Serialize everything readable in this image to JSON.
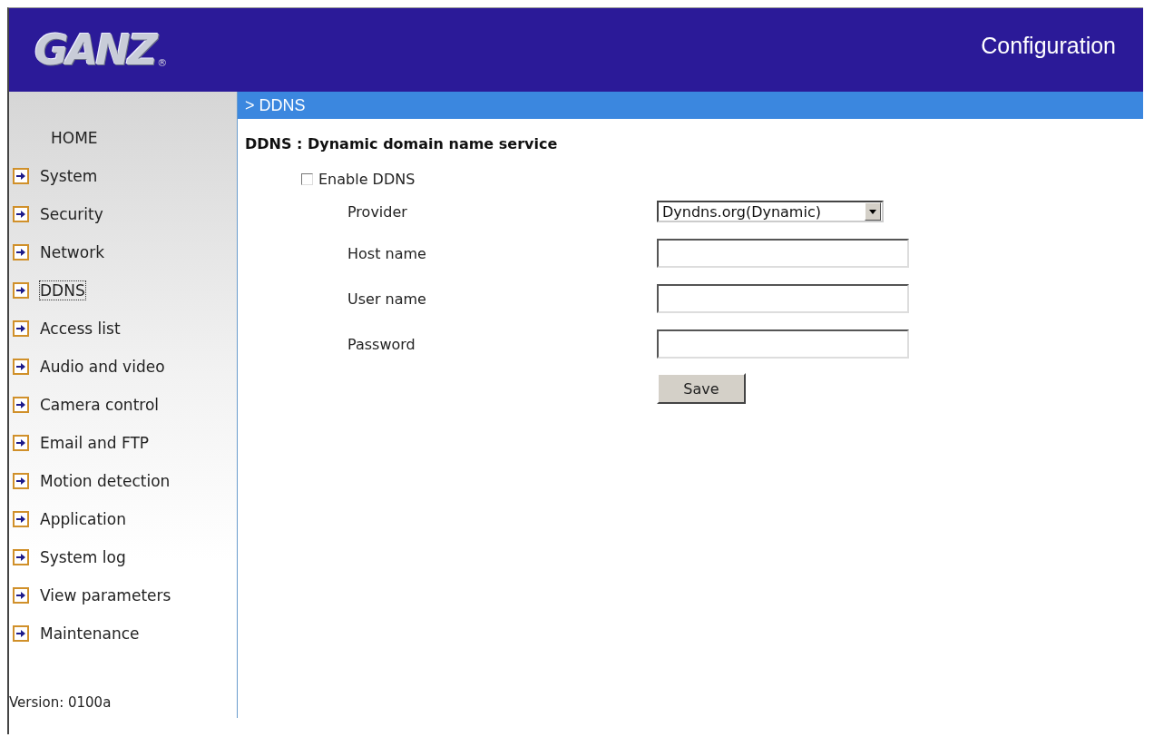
{
  "header": {
    "logo": "GANZ",
    "logo_mark": "®",
    "title": "Configuration"
  },
  "sidebar": {
    "items": [
      {
        "label": "HOME",
        "kind": "home",
        "selected": false
      },
      {
        "label": "System",
        "kind": "link",
        "selected": false
      },
      {
        "label": "Security",
        "kind": "link",
        "selected": false
      },
      {
        "label": "Network",
        "kind": "link",
        "selected": false
      },
      {
        "label": "DDNS",
        "kind": "link",
        "selected": true
      },
      {
        "label": "Access list",
        "kind": "link",
        "selected": false
      },
      {
        "label": "Audio and video",
        "kind": "link",
        "selected": false
      },
      {
        "label": "Camera control",
        "kind": "link",
        "selected": false
      },
      {
        "label": "Email and FTP",
        "kind": "link",
        "selected": false
      },
      {
        "label": "Motion detection",
        "kind": "link",
        "selected": false
      },
      {
        "label": "Application",
        "kind": "link",
        "selected": false
      },
      {
        "label": "System log",
        "kind": "link",
        "selected": false
      },
      {
        "label": "View parameters",
        "kind": "link",
        "selected": false
      },
      {
        "label": "Maintenance",
        "kind": "link",
        "selected": false
      }
    ],
    "version": "Version: 0100a"
  },
  "breadcrumb": "> DDNS",
  "section_title": "DDNS : Dynamic domain name service",
  "enable": {
    "label": "Enable DDNS",
    "checked": false
  },
  "fields": [
    {
      "label": "Provider",
      "kind": "select",
      "value": "Dyndns.org(Dynamic)"
    },
    {
      "label": "Host name",
      "kind": "text"
    },
    {
      "label": "User name",
      "kind": "text"
    },
    {
      "label": "Password",
      "kind": "password"
    }
  ],
  "save_button": "Save"
}
